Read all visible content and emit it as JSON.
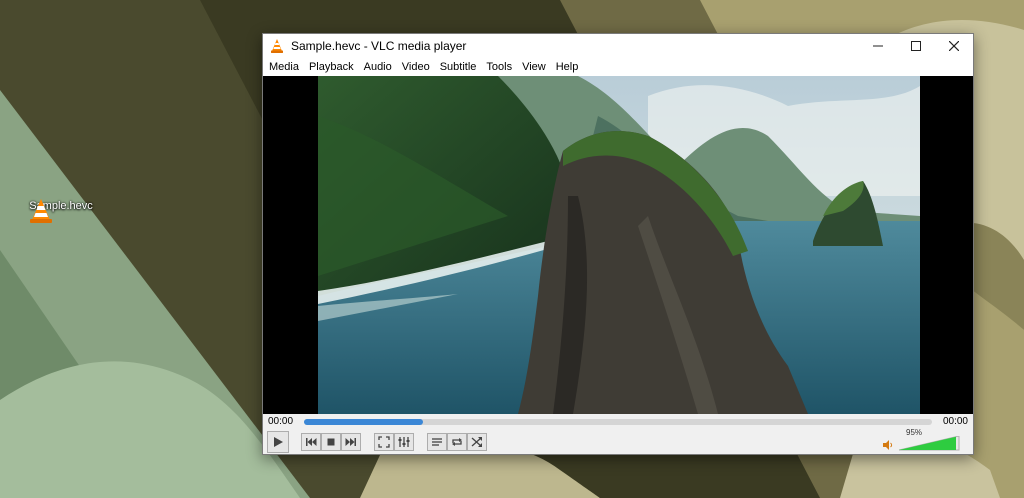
{
  "desktop": {
    "icons": [
      {
        "label": "Sample.hevc",
        "icon": "vlc-cone-icon"
      }
    ]
  },
  "window": {
    "title": "Sample.hevc - VLC media player",
    "minimize_icon": "minimize-icon",
    "maximize_icon": "maximize-icon",
    "close_icon": "close-icon",
    "menu": [
      "Media",
      "Playback",
      "Audio",
      "Video",
      "Subtitle",
      "Tools",
      "View",
      "Help"
    ]
  },
  "player": {
    "time_elapsed": "00:00",
    "time_total": "00:00",
    "progress": 0.19,
    "volume_label": "95%",
    "volume": 0.95,
    "colors": {
      "accent": "#3b87d6",
      "volume": "#2ecc40"
    },
    "buttons": [
      "play-icon",
      "previous-icon",
      "stop-icon",
      "next-icon",
      "fullscreen-icon",
      "extended-settings-icon",
      "playlist-icon",
      "loop-icon",
      "shuffle-icon",
      "speaker-icon"
    ]
  }
}
